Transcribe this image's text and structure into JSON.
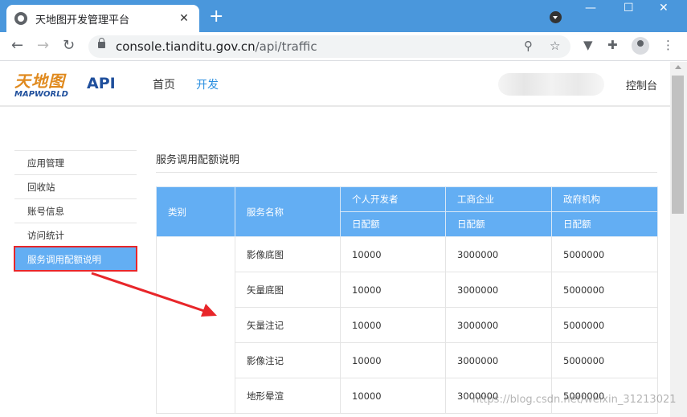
{
  "browser": {
    "tab_title": "天地图开发管理平台",
    "tab_close": "✕",
    "new_tab": "+",
    "url_host": "console.tianditu.gov.cn",
    "url_path": "/api/traffic",
    "window_controls": [
      "—",
      "☐",
      "✕"
    ],
    "icons": [
      "back-arrow",
      "forward-arrow",
      "reload",
      "lock",
      "zoom",
      "star",
      "extension",
      "puzzle",
      "profile",
      "menu"
    ]
  },
  "site": {
    "logo_cn": "天地图",
    "logo_en": "MAPWORLD",
    "api_label": "API",
    "nav": [
      "首页",
      "开发"
    ],
    "active_nav": "开发",
    "console": "控制台"
  },
  "sidebar": {
    "items": [
      {
        "label": "应用管理"
      },
      {
        "label": "回收站"
      },
      {
        "label": "账号信息"
      },
      {
        "label": "访问统计"
      },
      {
        "label": "服务调用配额说明"
      }
    ],
    "active_index": 4
  },
  "content": {
    "title": "服务调用配额说明",
    "table": {
      "col_category": "类别",
      "col_service": "服务名称",
      "groups": [
        "个人开发者",
        "工商企业",
        "政府机构"
      ],
      "sub_header": "日配额",
      "rows": [
        {
          "service": "影像底图",
          "personal": "10000",
          "business": "3000000",
          "government": "5000000"
        },
        {
          "service": "矢量底图",
          "personal": "10000",
          "business": "3000000",
          "government": "5000000"
        },
        {
          "service": "矢量注记",
          "personal": "10000",
          "business": "3000000",
          "government": "5000000"
        },
        {
          "service": "影像注记",
          "personal": "10000",
          "business": "3000000",
          "government": "5000000"
        },
        {
          "service": "地形晕渲",
          "personal": "10000",
          "business": "3000000",
          "government": "5000000"
        }
      ]
    }
  },
  "annotation": {
    "arrow_color": "#e8262a",
    "highlight_color": "#e8262a"
  },
  "watermark": "https://blog.csdn.net/weixin_31213021",
  "colors": {
    "chrome_blue": "#4a97dc",
    "table_header": "#63aef3",
    "brand_orange": "#e08a1e",
    "brand_blue": "#1f4f9c",
    "active_link": "#2b8fe0"
  }
}
